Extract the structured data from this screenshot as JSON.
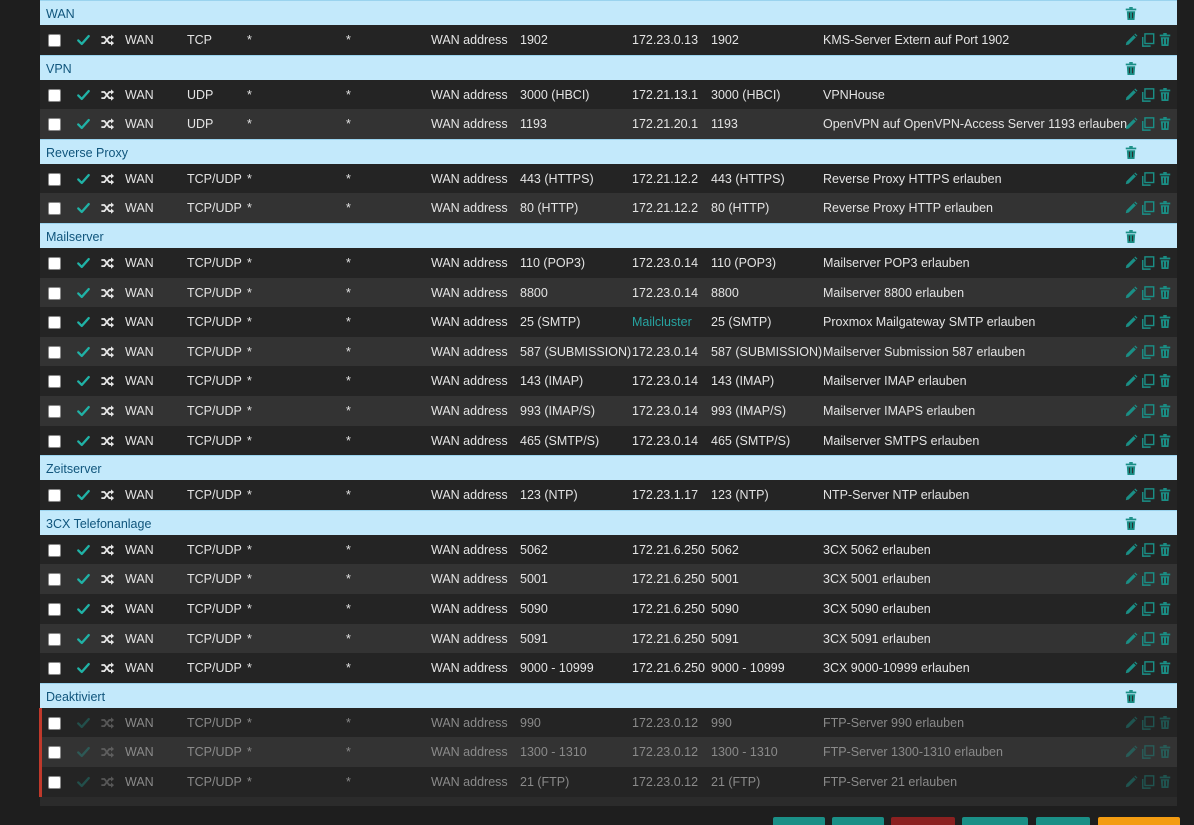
{
  "colors": {
    "accent": "#20b2a6",
    "group_bg": "#c3e9fb",
    "group_text": "#10557c",
    "disabled_bar": "#c0392b",
    "button_teal": "#1a8f86",
    "button_red": "#8b2020",
    "button_orange": "#f39c12"
  },
  "icons": {
    "enabled": "check-icon",
    "type": "shuffle-icon",
    "edit": "pencil-icon",
    "copy": "copy-icon",
    "delete": "trash-icon"
  },
  "groups": [
    {
      "name": "WAN",
      "rules": [
        {
          "iface": "WAN",
          "proto": "TCP",
          "src": "*",
          "sport": "*",
          "dst": "WAN address",
          "dport": "1902",
          "nat_ip": "172.23.0.13",
          "nat_port": "1902",
          "desc": "KMS-Server Extern auf Port 1902"
        }
      ]
    },
    {
      "name": "VPN",
      "rules": [
        {
          "iface": "WAN",
          "proto": "UDP",
          "src": "*",
          "sport": "*",
          "dst": "WAN address",
          "dport": "3000 (HBCI)",
          "nat_ip": "172.21.13.1",
          "nat_port": "3000 (HBCI)",
          "desc": "VPNHouse"
        },
        {
          "iface": "WAN",
          "proto": "UDP",
          "src": "*",
          "sport": "*",
          "dst": "WAN address",
          "dport": "1193",
          "nat_ip": "172.21.20.1",
          "nat_port": "1193",
          "desc": "OpenVPN auf OpenVPN-Access Server 1193 erlauben"
        }
      ]
    },
    {
      "name": "Reverse Proxy",
      "rules": [
        {
          "iface": "WAN",
          "proto": "TCP/UDP",
          "src": "*",
          "sport": "*",
          "dst": "WAN address",
          "dport": "443 (HTTPS)",
          "nat_ip": "172.21.12.2",
          "nat_port": "443 (HTTPS)",
          "desc": "Reverse Proxy HTTPS erlauben"
        },
        {
          "iface": "WAN",
          "proto": "TCP/UDP",
          "src": "*",
          "sport": "*",
          "dst": "WAN address",
          "dport": "80 (HTTP)",
          "nat_ip": "172.21.12.2",
          "nat_port": "80 (HTTP)",
          "desc": "Reverse Proxy HTTP erlauben"
        }
      ]
    },
    {
      "name": "Mailserver",
      "rules": [
        {
          "iface": "WAN",
          "proto": "TCP/UDP",
          "src": "*",
          "sport": "*",
          "dst": "WAN address",
          "dport": "110 (POP3)",
          "nat_ip": "172.23.0.14",
          "nat_port": "110 (POP3)",
          "desc": "Mailserver POP3 erlauben"
        },
        {
          "iface": "WAN",
          "proto": "TCP/UDP",
          "src": "*",
          "sport": "*",
          "dst": "WAN address",
          "dport": "8800",
          "nat_ip": "172.23.0.14",
          "nat_port": "8800",
          "desc": "Mailserver 8800 erlauben"
        },
        {
          "iface": "WAN",
          "proto": "TCP/UDP",
          "src": "*",
          "sport": "*",
          "dst": "WAN address",
          "dport": "25 (SMTP)",
          "nat_ip": "Mailcluster",
          "nat_alias": true,
          "nat_port": "25 (SMTP)",
          "desc": "Proxmox Mailgateway SMTP erlauben"
        },
        {
          "iface": "WAN",
          "proto": "TCP/UDP",
          "src": "*",
          "sport": "*",
          "dst": "WAN address",
          "dport": "587 (SUBMISSION)",
          "nat_ip": "172.23.0.14",
          "nat_port": "587 (SUBMISSION)",
          "desc": "Mailserver Submission 587 erlauben"
        },
        {
          "iface": "WAN",
          "proto": "TCP/UDP",
          "src": "*",
          "sport": "*",
          "dst": "WAN address",
          "dport": "143 (IMAP)",
          "nat_ip": "172.23.0.14",
          "nat_port": "143 (IMAP)",
          "desc": "Mailserver IMAP erlauben"
        },
        {
          "iface": "WAN",
          "proto": "TCP/UDP",
          "src": "*",
          "sport": "*",
          "dst": "WAN address",
          "dport": "993 (IMAP/S)",
          "nat_ip": "172.23.0.14",
          "nat_port": "993 (IMAP/S)",
          "desc": "Mailserver IMAPS erlauben"
        },
        {
          "iface": "WAN",
          "proto": "TCP/UDP",
          "src": "*",
          "sport": "*",
          "dst": "WAN address",
          "dport": "465 (SMTP/S)",
          "nat_ip": "172.23.0.14",
          "nat_port": "465 (SMTP/S)",
          "desc": "Mailserver SMTPS erlauben"
        }
      ]
    },
    {
      "name": "Zeitserver",
      "rules": [
        {
          "iface": "WAN",
          "proto": "TCP/UDP",
          "src": "*",
          "sport": "*",
          "dst": "WAN address",
          "dport": "123 (NTP)",
          "nat_ip": "172.23.1.17",
          "nat_port": "123 (NTP)",
          "desc": "NTP-Server NTP erlauben"
        }
      ]
    },
    {
      "name": "3CX Telefonanlage",
      "rules": [
        {
          "iface": "WAN",
          "proto": "TCP/UDP",
          "src": "*",
          "sport": "*",
          "dst": "WAN address",
          "dport": "5062",
          "nat_ip": "172.21.6.250",
          "nat_port": "5062",
          "desc": "3CX 5062 erlauben"
        },
        {
          "iface": "WAN",
          "proto": "TCP/UDP",
          "src": "*",
          "sport": "*",
          "dst": "WAN address",
          "dport": "5001",
          "nat_ip": "172.21.6.250",
          "nat_port": "5001",
          "desc": "3CX 5001 erlauben"
        },
        {
          "iface": "WAN",
          "proto": "TCP/UDP",
          "src": "*",
          "sport": "*",
          "dst": "WAN address",
          "dport": "5090",
          "nat_ip": "172.21.6.250",
          "nat_port": "5090",
          "desc": "3CX 5090 erlauben"
        },
        {
          "iface": "WAN",
          "proto": "TCP/UDP",
          "src": "*",
          "sport": "*",
          "dst": "WAN address",
          "dport": "5091",
          "nat_ip": "172.21.6.250",
          "nat_port": "5091",
          "desc": "3CX 5091 erlauben"
        },
        {
          "iface": "WAN",
          "proto": "TCP/UDP",
          "src": "*",
          "sport": "*",
          "dst": "WAN address",
          "dport": "9000 - 10999",
          "nat_ip": "172.21.6.250",
          "nat_port": "9000 - 10999",
          "desc": "3CX 9000-10999 erlauben"
        }
      ]
    },
    {
      "name": "Deaktiviert",
      "disabled": true,
      "rules": [
        {
          "iface": "WAN",
          "proto": "TCP/UDP",
          "src": "*",
          "sport": "*",
          "dst": "WAN address",
          "dport": "990",
          "nat_ip": "172.23.0.12",
          "nat_port": "990",
          "desc": "FTP-Server 990 erlauben"
        },
        {
          "iface": "WAN",
          "proto": "TCP/UDP",
          "src": "*",
          "sport": "*",
          "dst": "WAN address",
          "dport": "1300 - 1310",
          "nat_ip": "172.23.0.12",
          "nat_port": "1300 - 1310",
          "desc": "FTP-Server 1300-1310 erlauben"
        },
        {
          "iface": "WAN",
          "proto": "TCP/UDP",
          "src": "*",
          "sport": "*",
          "dst": "WAN address",
          "dport": "21 (FTP)",
          "nat_ip": "172.23.0.12",
          "nat_port": "21 (FTP)",
          "desc": "FTP-Server 21 erlauben"
        }
      ]
    }
  ]
}
